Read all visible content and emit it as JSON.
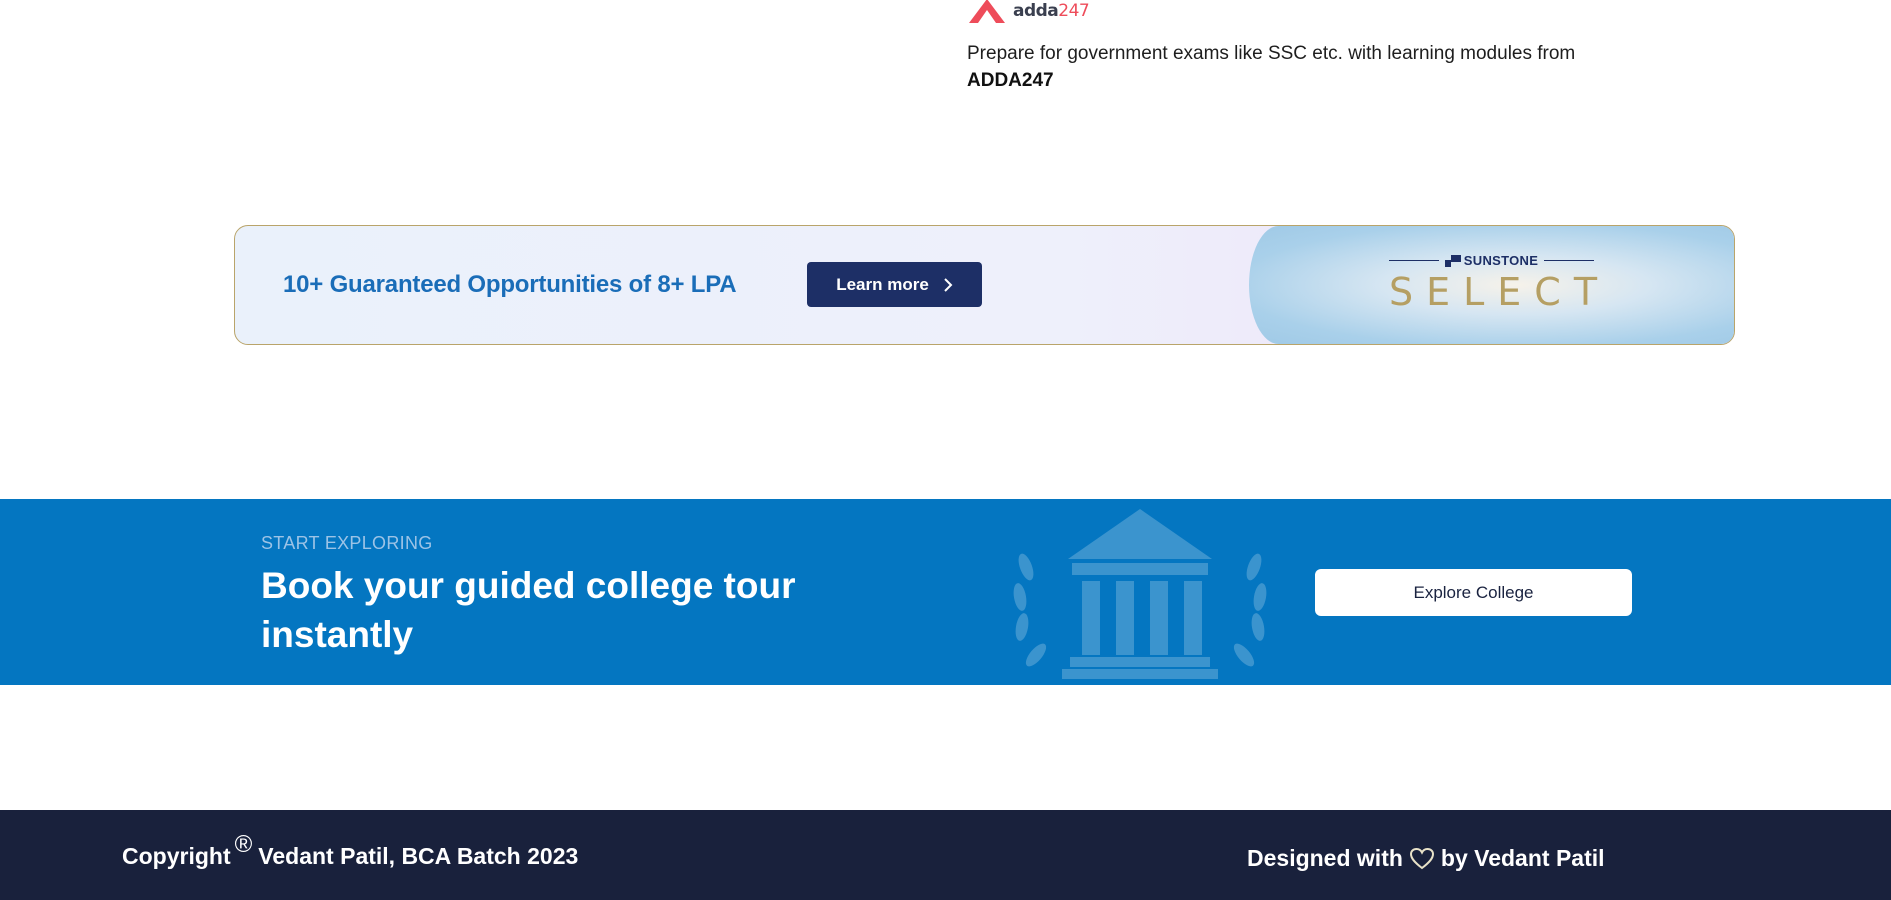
{
  "partner": {
    "logo_word": "adda",
    "logo_num": "247",
    "description": "Prepare for government exams like SSC etc. with learning modules from",
    "brand": "ADDA247"
  },
  "banner": {
    "headline": "10+ Guaranteed Opportunities of 8+ LPA",
    "button_label": "Learn more",
    "brand_name": "SUNSTONE",
    "brand_product": "SELECT",
    "colors": {
      "headline": "#1a6db8",
      "button": "#1d2f66",
      "gold": "#b59f63"
    }
  },
  "explore": {
    "kicker": "START EXPLORING",
    "title": "Book your guided college tour instantly",
    "button_label": "Explore College",
    "colors": {
      "background": "#0476c1"
    },
    "art_icon": "college-building-icon"
  },
  "footer": {
    "copyright_prefix": "Copyright",
    "copyright_symbol": "®",
    "copyright_owner": "Vedant Patil, BCA Batch 2023",
    "designed_prefix": "Designed with",
    "designed_suffix": "by Vedant Patil",
    "heart_icon": "heart-icon",
    "colors": {
      "background": "#19213c"
    }
  }
}
